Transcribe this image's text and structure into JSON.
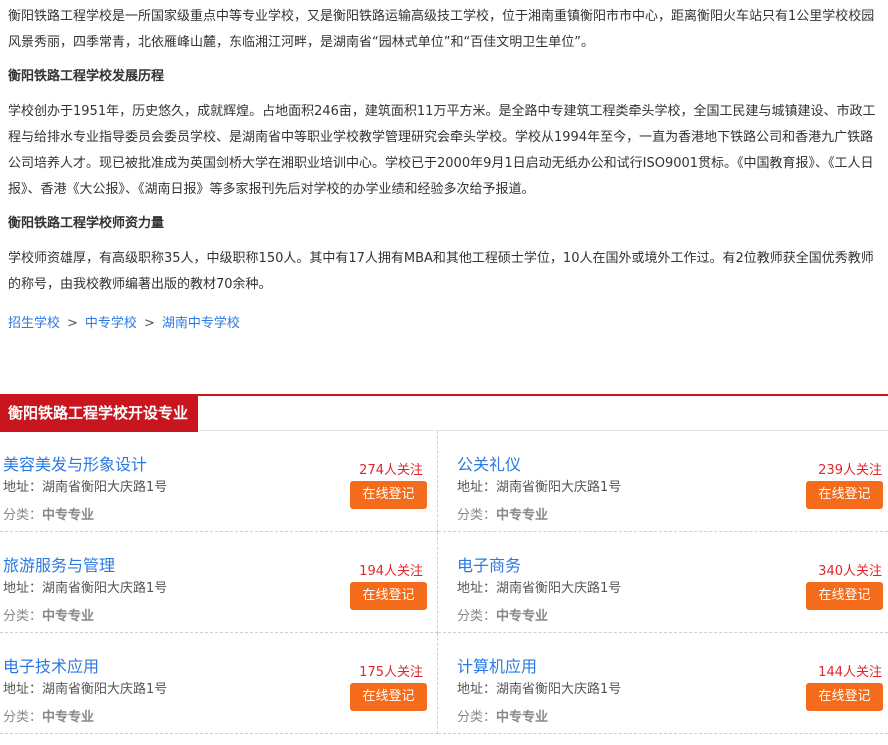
{
  "article": {
    "intro": "衡阳铁路工程学校是一所国家级重点中等专业学校，又是衡阳铁路运输高级技工学校，位于湘南重镇衡阳市市中心，距离衡阳火车站只有1公里学校校园风景秀丽，四季常青，北依雁峰山麓，东临湘江河畔，是湖南省“园林式单位”和“百佳文明卫生单位”。",
    "history_heading": "衡阳铁路工程学校发展历程",
    "history_text": "学校创办于1951年，历史悠久，成就辉煌。占地面积246亩，建筑面积11万平方米。是全路中专建筑工程类牵头学校，全国工民建与城镇建设、市政工程与给排水专业指导委员会委员学校、是湖南省中等职业学校教学管理研究会牵头学校。学校从1994年至今，一直为香港地下铁路公司和香港九广铁路公司培养人才。现已被批准成为英国剑桥大学在湘职业培训中心。学校已于2000年9月1日启动无纸办公和试行ISO9001贯标。《中国教育报》、《工人日报》、香港《大公报》、《湖南日报》等多家报刊先后对学校的办学业绩和经验多次给予报道。",
    "faculty_heading": "衡阳铁路工程学校师资力量",
    "faculty_text": "学校师资雄厚，有高级职称35人，中级职称150人。其中有17人拥有MBA和其他工程硕士学位，10人在国外或境外工作过。有2位教师获全国优秀教师的称号，由我校教师编著出版的教材70余种。"
  },
  "breadcrumb": {
    "items": [
      "招生学校",
      "中专学校",
      "湖南中专学校"
    ],
    "separator": ">"
  },
  "majors": {
    "title": "衡阳铁路工程学校开设专业",
    "address_prefix": "地址：",
    "category_prefix": "分类：",
    "button_label": "在线登记",
    "items": [
      {
        "name": "美容美发与形象设计",
        "follow": "274人关注",
        "address": "湖南省衡阳大庆路1号",
        "category": "中专专业"
      },
      {
        "name": "公关礼仪",
        "follow": "239人关注",
        "address": "湖南省衡阳大庆路1号",
        "category": "中专专业"
      },
      {
        "name": "旅游服务与管理",
        "follow": "194人关注",
        "address": "湖南省衡阳大庆路1号",
        "category": "中专专业"
      },
      {
        "name": "电子商务",
        "follow": "340人关注",
        "address": "湖南省衡阳大庆路1号",
        "category": "中专专业"
      },
      {
        "name": "电子技术应用",
        "follow": "175人关注",
        "address": "湖南省衡阳大庆路1号",
        "category": "中专专业"
      },
      {
        "name": "计算机应用",
        "follow": "144人关注",
        "address": "湖南省衡阳大庆路1号",
        "category": "中专专业"
      }
    ]
  },
  "colors": {
    "accent_red": "#c9151e",
    "link_blue": "#2a7ae2",
    "button_orange": "#f46b1c",
    "follow_red": "#e0262c"
  }
}
